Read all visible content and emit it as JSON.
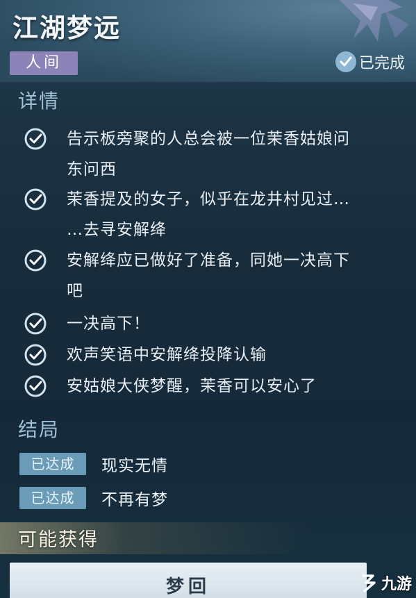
{
  "header": {
    "title": "江湖梦远",
    "tag": "人间",
    "status": "已完成"
  },
  "details": {
    "heading": "详情",
    "items": [
      {
        "lines": [
          "告示板旁聚的人总会被一位茉香姑娘问",
          "东问西"
        ]
      },
      {
        "lines": [
          "茉香提及的女子，似乎在龙井村见过…",
          "…去寻安解绛"
        ]
      },
      {
        "lines": [
          "安解绛应已做好了准备，同她一决高下",
          "吧"
        ]
      },
      {
        "lines": [
          "一决高下！"
        ]
      },
      {
        "lines": [
          "欢声笑语中安解绛投降认输"
        ]
      },
      {
        "lines": [
          "安姑娘大侠梦醒，茉香可以安心了"
        ]
      }
    ]
  },
  "ending": {
    "heading": "结局",
    "rows": [
      {
        "badge": "已达成",
        "text": "现实无情"
      },
      {
        "badge": "已达成",
        "text": "不再有梦"
      }
    ]
  },
  "rewards": {
    "heading": "可能获得",
    "button": "梦回"
  },
  "watermark": {
    "text": "九游"
  },
  "colors": {
    "tag_bg": "#8c84b8",
    "badge_bg": "#6a9cb7",
    "check_ring": "#cfe2ee",
    "heading": "#9fc0d6"
  }
}
